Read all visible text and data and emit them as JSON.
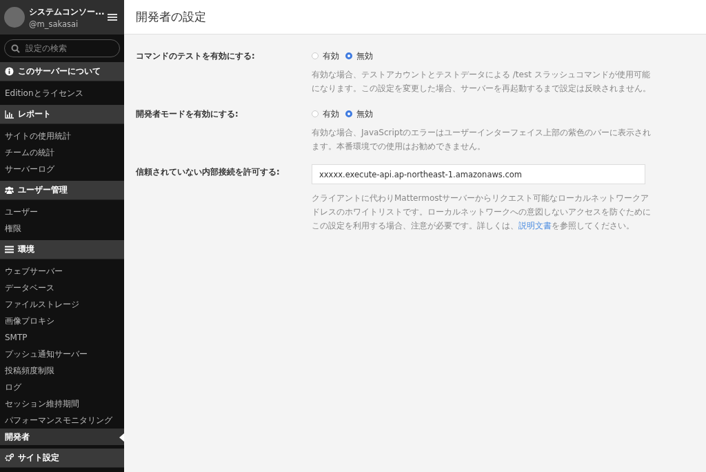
{
  "sidebar": {
    "team_name": "システムコンソー...",
    "username": "@m_sakasai",
    "search": {
      "placeholder": "設定の検索"
    },
    "items": [
      {
        "kind": "section",
        "label": "このサーバーについて",
        "selected": false
      },
      {
        "kind": "item",
        "label": "Editionとライセンス",
        "selected": false
      },
      {
        "kind": "section",
        "label": "レポート",
        "selected": false
      },
      {
        "kind": "item",
        "label": "サイトの使用統計",
        "selected": false
      },
      {
        "kind": "item",
        "label": "チームの統計",
        "selected": false
      },
      {
        "kind": "item",
        "label": "サーバーログ",
        "selected": false
      },
      {
        "kind": "section",
        "label": "ユーザー管理",
        "selected": false
      },
      {
        "kind": "item",
        "label": "ユーザー",
        "selected": false
      },
      {
        "kind": "item",
        "label": "権限",
        "selected": false
      },
      {
        "kind": "section",
        "label": "環境",
        "selected": false
      },
      {
        "kind": "item",
        "label": "ウェブサーバー",
        "selected": false
      },
      {
        "kind": "item",
        "label": "データベース",
        "selected": false
      },
      {
        "kind": "item",
        "label": "ファイルストレージ",
        "selected": false
      },
      {
        "kind": "item",
        "label": "画像プロキシ",
        "selected": false
      },
      {
        "kind": "item",
        "label": "SMTP",
        "selected": false
      },
      {
        "kind": "item",
        "label": "プッシュ通知サーバー",
        "selected": false
      },
      {
        "kind": "item",
        "label": "投稿頻度制限",
        "selected": false
      },
      {
        "kind": "item",
        "label": "ログ",
        "selected": false
      },
      {
        "kind": "item",
        "label": "セッション維持期間",
        "selected": false
      },
      {
        "kind": "item",
        "label": "パフォーマンスモニタリング",
        "selected": false
      },
      {
        "kind": "item",
        "label": "開発者",
        "selected": true
      },
      {
        "kind": "section",
        "label": "サイト設定",
        "selected": false
      }
    ]
  },
  "page": {
    "title": "開発者の設定",
    "settings": [
      {
        "kind": "radio",
        "label": "コマンドのテストを有効にする:",
        "options": [
          {
            "label": "有効",
            "selected": false
          },
          {
            "label": "無効",
            "selected": true
          }
        ],
        "help": "有効な場合、テストアカウントとテストデータによる /test スラッシュコマンドが使用可能になります。この設定を変更した場合、サーバーを再起動するまで設定は反映されません。"
      },
      {
        "kind": "radio",
        "label": "開発者モードを有効にする:",
        "options": [
          {
            "label": "有効",
            "selected": false
          },
          {
            "label": "無効",
            "selected": true
          }
        ],
        "help": "有効な場合、JavaScriptのエラーはユーザーインターフェイス上部の紫色のバーに表示されます。本番環境での使用はお勧めできません。"
      },
      {
        "kind": "text",
        "label": "信頼されていない内部接続を許可する:",
        "value": "xxxxx.execute-api.ap-northeast-1.amazonaws.com",
        "help": "クライアントに代わりMattermostサーバーからリクエスト可能なローカルネットワークアドレスのホワイトリストです。ローカルネットワークへの意図しないアクセスを防ぐためにこの設定を利用する場合、注意が必要です。詳しくは、",
        "help_link": "説明文書",
        "help_after": "を参照してください。"
      }
    ]
  }
}
